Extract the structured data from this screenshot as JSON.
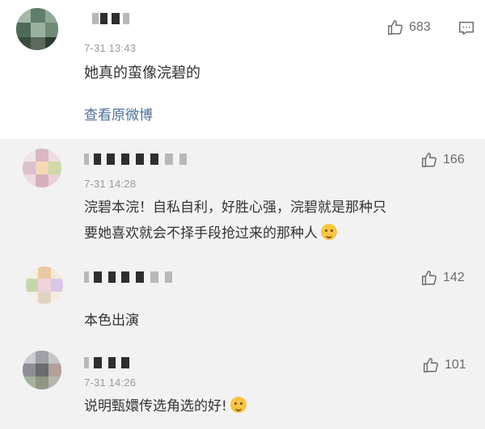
{
  "main_comment": {
    "time": "7-31 13:43",
    "likes": "683",
    "text": "她真的蛮像浣碧的",
    "view_original_link": "查看原微博"
  },
  "replies": [
    {
      "time": "7-31 14:28",
      "likes": "166",
      "text_line1": "浣碧本浣！自私自利，好胜心强，浣碧就是那种只",
      "text_line2": "要她喜欢就会不择手段抢过来的那种人"
    },
    {
      "time": "",
      "likes": "142",
      "text": "本色出演"
    },
    {
      "time": "7-31 14:26",
      "likes": "101",
      "text": "说明甄嬛传选角选的好!"
    }
  ],
  "icons": {
    "like": "thumbs-up-icon",
    "comment": "comment-bubble-icon",
    "emoji": "emoji-icon"
  },
  "colors": {
    "link": "#4e6e9a",
    "text": "#333333",
    "muted": "#9a9a9a",
    "reply_bg": "#f2f2f2"
  }
}
